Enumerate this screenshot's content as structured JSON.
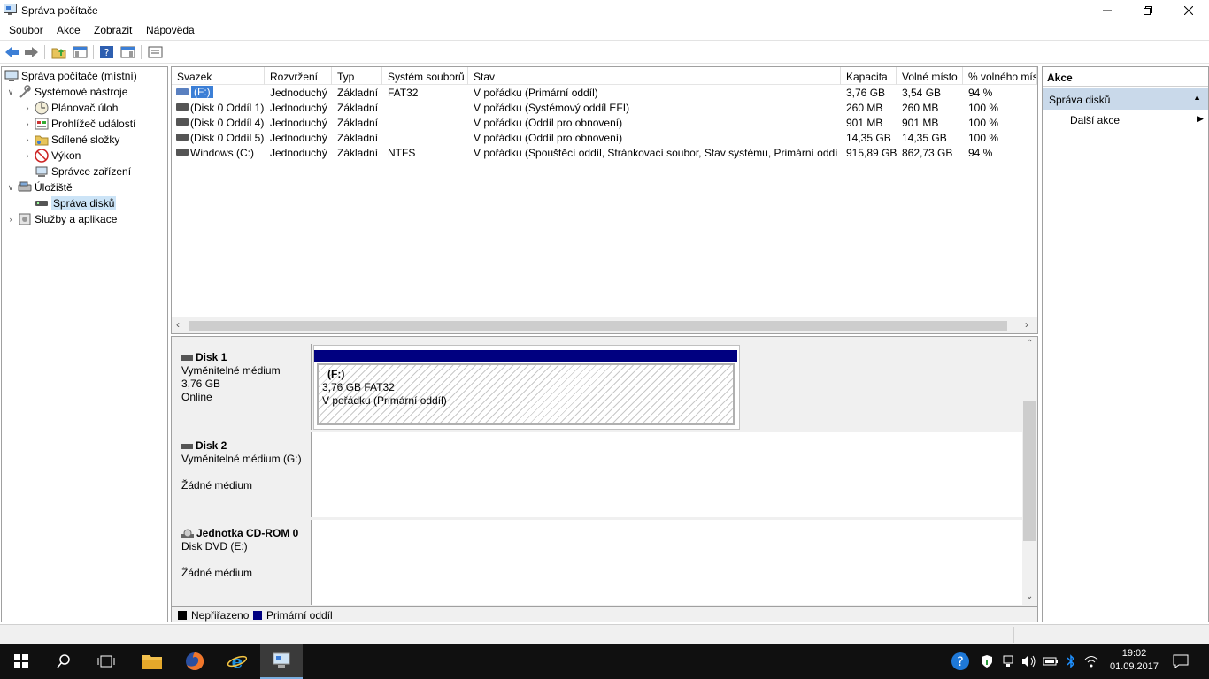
{
  "window": {
    "title": "Správa počítače"
  },
  "menu": [
    "Soubor",
    "Akce",
    "Zobrazit",
    "Nápověda"
  ],
  "tree": {
    "root": "Správa počítače (místní)",
    "system_tools": "Systémové nástroje",
    "task_scheduler": "Plánovač úloh",
    "event_viewer": "Prohlížeč událostí",
    "shared_folders": "Sdílené složky",
    "performance": "Výkon",
    "device_manager": "Správce zařízení",
    "storage": "Úložiště",
    "disk_management": "Správa disků",
    "services": "Služby a aplikace"
  },
  "volumes": {
    "columns": [
      "Svazek",
      "Rozvržení",
      "Typ",
      "Systém souborů",
      "Stav",
      "Kapacita",
      "Volné místo",
      "% volného mís"
    ],
    "rows": [
      [
        "(F:)",
        "Jednoduchý",
        "Základní",
        "FAT32",
        "V pořádku (Primární oddíl)",
        "3,76 GB",
        "3,54 GB",
        "94 %"
      ],
      [
        "(Disk 0 Oddíl 1)",
        "Jednoduchý",
        "Základní",
        "",
        "V pořádku (Systémový oddíl EFI)",
        "260 MB",
        "260 MB",
        "100 %"
      ],
      [
        "(Disk 0 Oddíl 4)",
        "Jednoduchý",
        "Základní",
        "",
        "V pořádku (Oddíl pro obnovení)",
        "901 MB",
        "901 MB",
        "100 %"
      ],
      [
        "(Disk 0 Oddíl 5)",
        "Jednoduchý",
        "Základní",
        "",
        "V pořádku (Oddíl pro obnovení)",
        "14,35 GB",
        "14,35 GB",
        "100 %"
      ],
      [
        "Windows (C:)",
        "Jednoduchý",
        "Základní",
        "NTFS",
        "V pořádku (Spouštěcí oddíl, Stránkovací soubor, Stav systému, Primární oddíl)",
        "915,89 GB",
        "862,73 GB",
        "94 %"
      ]
    ]
  },
  "disks": [
    {
      "name": "Disk 1",
      "line1": "Vyměnitelné médium",
      "line2": "3,76 GB",
      "line3": "Online",
      "partition": {
        "title": "(F:)",
        "size": "3,76 GB FAT32",
        "status": "V pořádku (Primární oddíl)"
      }
    },
    {
      "name": "Disk 2",
      "line1": "Vyměnitelné médium (G:)",
      "line2": "",
      "line3": "Žádné médium"
    },
    {
      "name": "Jednotka CD-ROM 0",
      "line1": "Disk DVD (E:)",
      "line2": "",
      "line3": "Žádné médium"
    }
  ],
  "legend": {
    "unallocated": "Nepřiřazeno",
    "primary": "Primární oddíl"
  },
  "colors": {
    "primary_partition": "#000080",
    "unallocated": "#000000",
    "selection": "#cce4f7",
    "actions_section": "#c9d9ea"
  },
  "actions": {
    "header": "Akce",
    "section": "Správa disků",
    "more": "Další akce"
  },
  "taskbar": {
    "time": "19:02",
    "date": "01.09.2017"
  }
}
